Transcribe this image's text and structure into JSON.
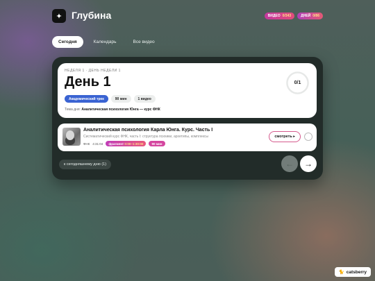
{
  "app": {
    "logo_glyph": "✦",
    "title": "Глубина"
  },
  "badges": {
    "video": {
      "label": "ВИДЕО",
      "value": "0/343"
    },
    "days": {
      "label": "ДНЕЙ",
      "value": "0/86"
    }
  },
  "tabs": [
    {
      "label": "Сегодня",
      "active": true
    },
    {
      "label": "Календарь",
      "active": false
    },
    {
      "label": "Все видео",
      "active": false
    }
  ],
  "day": {
    "week_label": "НЕДЕЛЯ 1 · ДЕНЬ НЕДЕЛИ 1",
    "title": "День 1",
    "chips": [
      "Академический трек",
      "90 мин",
      "1 видео"
    ],
    "topic_prefix": "Тема дня:",
    "topic": "Аналитическая психология Юнга — курс ФНК",
    "progress_text": "0/1",
    "progress": 0
  },
  "video": {
    "title": "Аналитическая психология Карла Юнга. Курс. Часть I",
    "description": "Систематический курс ФНК, часть I: структура психики, архетипы, комплексы",
    "channel": "ФНК",
    "length": "4:31:04",
    "fragment_label": "фрагмент",
    "fragment_range": "0:00–1:30:00",
    "duration_tag": "90 мин",
    "watch_label": "смотреть ▸"
  },
  "nav": {
    "back_label": "к сегодняшнему дню (1)",
    "prev_glyph": "←",
    "next_glyph": "→"
  },
  "brand": {
    "glyph": "🐈",
    "name": "catsberry"
  },
  "colors": {
    "accent_blue": "#3a63d2",
    "accent_pink": "#e24d7a",
    "panel": "#222c29"
  }
}
